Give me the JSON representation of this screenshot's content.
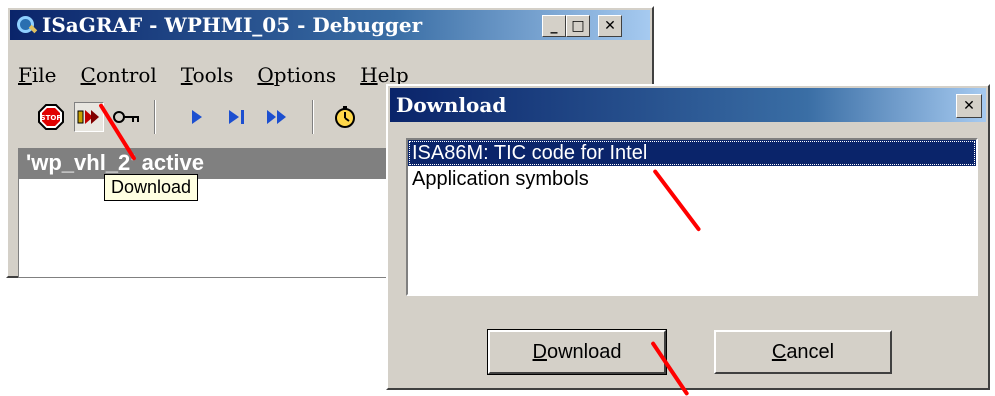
{
  "debugger": {
    "title": "ISaGRAF - WPHMI_05 - Debugger",
    "controls": {
      "minimize": "_",
      "maximize": "□",
      "close": "✕"
    },
    "menu": [
      {
        "accel": "F",
        "rest": "ile"
      },
      {
        "accel": "C",
        "rest": "ontrol"
      },
      {
        "accel": "T",
        "rest": "ools"
      },
      {
        "accel": "O",
        "rest": "ptions"
      },
      {
        "accel": "H",
        "rest": "elp"
      }
    ],
    "toolbar_icons": [
      "stop-icon",
      "download-icon",
      "key-icon",
      "run-icon",
      "step-icon",
      "fast-forward-icon",
      "timer-icon"
    ],
    "status": "'wp_vhl_2' active",
    "tooltip": "Download"
  },
  "dialog": {
    "title": "Download",
    "close": "✕",
    "items": [
      "ISA86M: TIC code for Intel",
      "Application symbols"
    ],
    "selected_index": 0,
    "buttons": {
      "download": {
        "accel": "D",
        "rest": "ownload"
      },
      "cancel": {
        "accel": "C",
        "rest": "ancel"
      }
    }
  },
  "colors": {
    "title_start": "#0a246a",
    "title_end": "#a6caf0",
    "face": "#d4d0c8",
    "annotation": "#ff0000"
  }
}
